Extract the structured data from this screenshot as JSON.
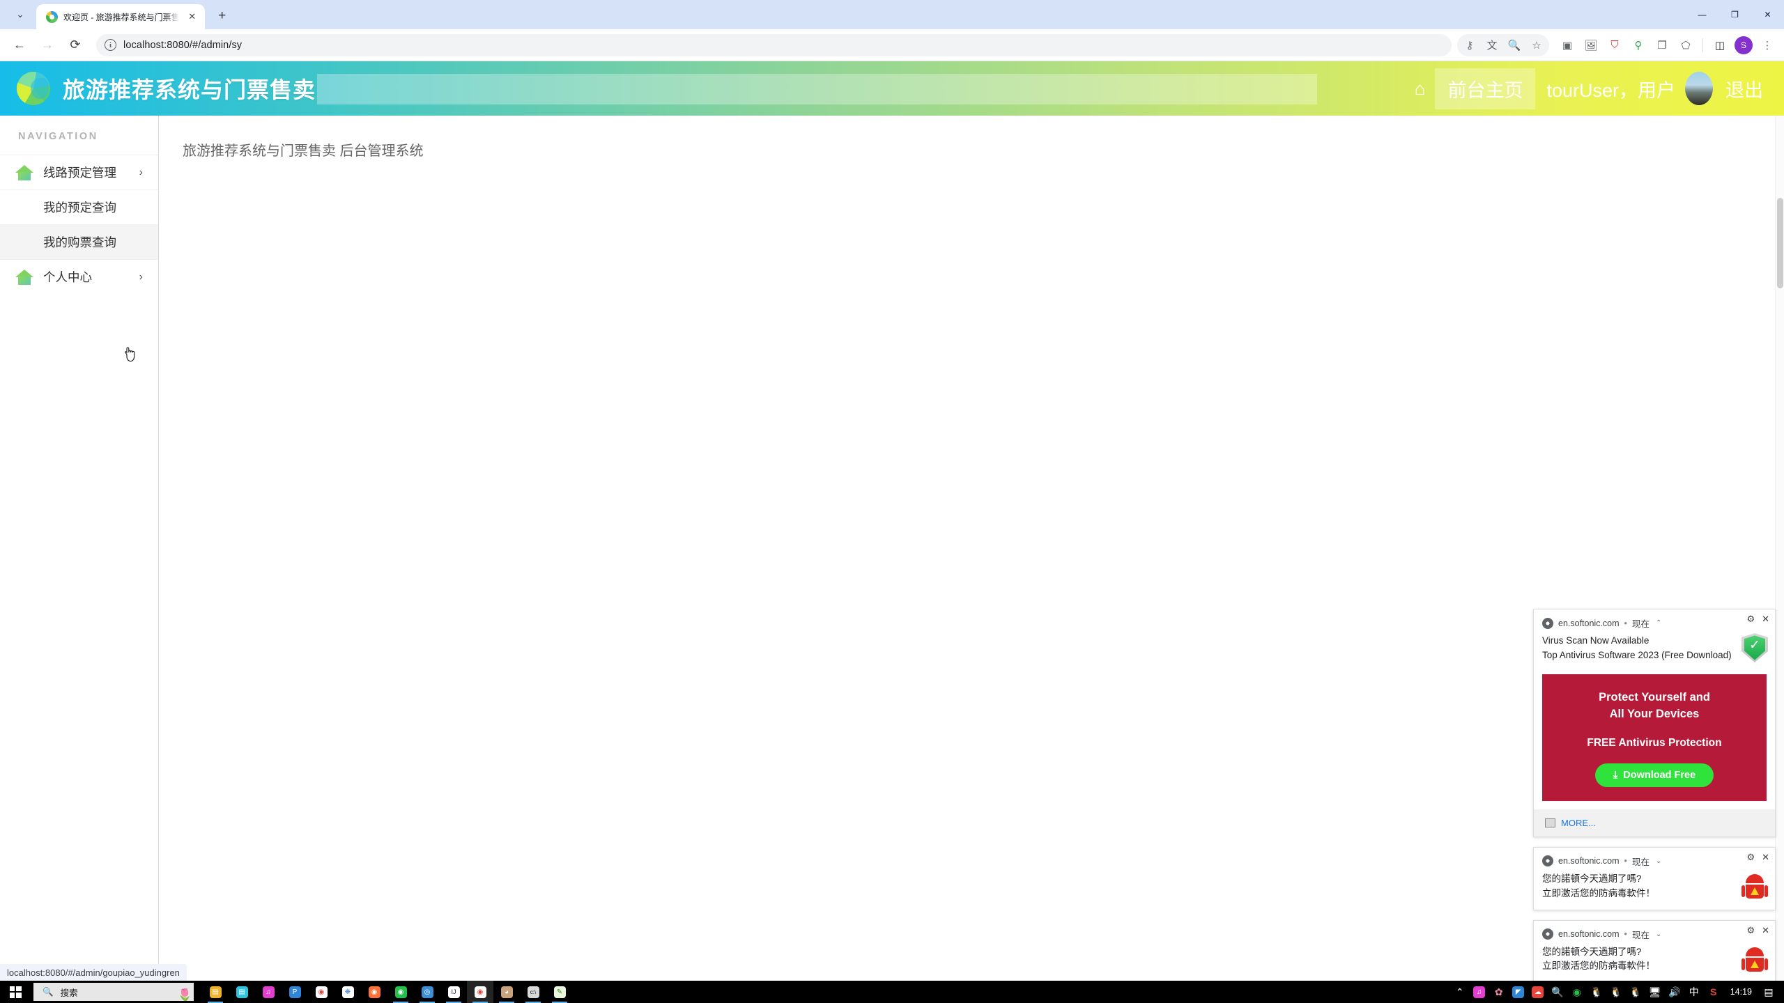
{
  "browser": {
    "tab": {
      "title": "欢迎页 - 旅游推荐系统与门票售",
      "close_label": "✕"
    },
    "new_tab_label": "+",
    "tab_chevron": "⌄",
    "window_controls": {
      "minimize": "—",
      "maximize": "❐",
      "close": "✕"
    },
    "nav": {
      "back": "←",
      "forward": "→",
      "reload": "⟳"
    },
    "omnibox": {
      "url": "localhost:8080/#/admin/sy",
      "info_icon": "i"
    },
    "toolbar_icons": [
      {
        "name": "password-key-icon",
        "glyph": "⚷"
      },
      {
        "name": "translate-icon",
        "glyph": "文"
      },
      {
        "name": "zoom-icon",
        "glyph": "🔍"
      },
      {
        "name": "bookmark-star-icon",
        "glyph": "☆"
      },
      {
        "name": "screenshot-camera-icon",
        "glyph": "▣"
      },
      {
        "name": "image-extension-icon",
        "glyph": "🖼"
      },
      {
        "name": "adblock-shield-icon",
        "glyph": "⛉"
      },
      {
        "name": "location-pin-icon",
        "glyph": "⚲"
      },
      {
        "name": "clipboard-copy-icon",
        "glyph": "❐"
      },
      {
        "name": "puzzle-extensions-icon",
        "glyph": "⬠"
      },
      {
        "name": "side-panel-icon",
        "glyph": "◫"
      },
      {
        "name": "profile-avatar",
        "glyph": "S"
      },
      {
        "name": "chrome-menu-icon",
        "glyph": "⋮"
      }
    ]
  },
  "app": {
    "header": {
      "title": "旅游推荐系统与门票售卖",
      "home_icon": "⌂",
      "front_page_button": "前台主页",
      "user_label": "tourUser，用户",
      "logout_label": "退出",
      "gradient_from": "#16bde8",
      "gradient_to": "#eef444"
    },
    "sidebar": {
      "section_label": "NAVIGATION",
      "items": [
        {
          "label": "线路预定管理",
          "icon": "home-icon",
          "chevron": "›",
          "has_icon": true,
          "sub": false,
          "active": false
        },
        {
          "label": "我的预定查询",
          "icon": "",
          "chevron": "",
          "has_icon": false,
          "sub": true,
          "active": false
        },
        {
          "label": "我的购票查询",
          "icon": "",
          "chevron": "",
          "has_icon": false,
          "sub": true,
          "active": true
        },
        {
          "label": "个人中心",
          "icon": "home-icon",
          "chevron": "›",
          "has_icon": true,
          "sub": false,
          "active": false
        }
      ]
    },
    "content": {
      "title": "旅游推荐系统与门票售卖 后台管理系统"
    }
  },
  "status_bar": {
    "url": "localhost:8080/#/admin/goupiao_yudingren"
  },
  "notifications": [
    {
      "source": "en.softonic.com",
      "separator": "•",
      "time": "现在",
      "caret": "⌃",
      "settings_icon": "⚙",
      "close_icon": "✕",
      "line1": "Virus Scan Now Available",
      "line2": "Top Antivirus Software 2023 (Free Download)",
      "image": "shield-check-icon",
      "promo": {
        "headline_1": "Protect Yourself and",
        "headline_2": "All Your Devices",
        "subline": "FREE Antivirus Protection",
        "button": "Download Free",
        "button_icon": "⤓",
        "bg_color": "#b51b38",
        "button_color": "#2fe23c"
      },
      "more_label": "MORE..."
    },
    {
      "source": "en.softonic.com",
      "separator": "•",
      "time": "现在",
      "caret": "⌄",
      "settings_icon": "⚙",
      "close_icon": "✕",
      "line1": "您的諾頓今天過期了嗎?",
      "line2": "立即激活您的防病毒軟件！",
      "image": "android-warning-icon"
    },
    {
      "source": "en.softonic.com",
      "separator": "•",
      "time": "现在",
      "caret": "⌄",
      "settings_icon": "⚙",
      "close_icon": "✕",
      "line1": "您的諾頓今天過期了嗎?",
      "line2": "立即激活您的防病毒軟件！",
      "image": "android-warning-icon"
    }
  ],
  "taskbar": {
    "start_label": "start-button",
    "search_placeholder": "搜索",
    "search_icon": "🔍",
    "apps": [
      {
        "name": "file-explorer-icon",
        "glyph": "🗂",
        "color": "#f0b429"
      },
      {
        "name": "toolbox-app-icon",
        "glyph": "▤",
        "color": "#2ec4e0"
      },
      {
        "name": "netease-music-icon",
        "glyph": "♫",
        "color": "#e23fd0"
      },
      {
        "name": "pdf-app-icon",
        "glyph": "P",
        "color": "#2f86d8"
      },
      {
        "name": "chrome-icon",
        "glyph": "◉",
        "color": "#e7453c"
      },
      {
        "name": "white-app-icon",
        "glyph": "❋",
        "color": "#ffffff"
      },
      {
        "name": "firefox-icon",
        "glyph": "◉",
        "color": "#ff7139"
      },
      {
        "name": "wechat-icon",
        "glyph": "◉",
        "color": "#23c04a"
      },
      {
        "name": "music-app-icon",
        "glyph": "◎",
        "color": "#3a8fd6"
      },
      {
        "name": "intellij-idea-icon",
        "glyph": "IJ",
        "color": "#ffffff"
      },
      {
        "name": "chrome-active-icon",
        "glyph": "◉",
        "color": "#e7453c"
      },
      {
        "name": "browser-app-icon",
        "glyph": "◕",
        "color": "#c9a27e"
      },
      {
        "name": "cmd-terminal-icon",
        "glyph": "▭",
        "color": "#d8d8d8"
      },
      {
        "name": "notepad-icon",
        "glyph": "✎",
        "color": "#8ed16b"
      }
    ],
    "tray": [
      {
        "name": "tray-expand-icon",
        "glyph": "⌃",
        "color": "#ffffff"
      },
      {
        "name": "netease-tray-icon",
        "glyph": "♫",
        "color": "#e23fd0"
      },
      {
        "name": "sakura-tray-icon",
        "glyph": "✿",
        "color": "#f48fb1"
      },
      {
        "name": "teambition-tray-icon",
        "glyph": "◤",
        "color": "#2f86d8"
      },
      {
        "name": "cloud-tray-icon",
        "glyph": "☁",
        "color": "#e7453c"
      },
      {
        "name": "search-tray-icon",
        "glyph": "🔍",
        "color": "#f0a429"
      },
      {
        "name": "wechat-tray-icon",
        "glyph": "◉",
        "color": "#23c04a"
      },
      {
        "name": "qq-tray-icon-1",
        "glyph": "🐧",
        "color": "#ffffff"
      },
      {
        "name": "qq-tray-icon-2",
        "glyph": "🐧",
        "color": "#ffffff"
      },
      {
        "name": "qq-tray-icon-3",
        "glyph": "🐧",
        "color": "#ffffff"
      },
      {
        "name": "network-tray-icon",
        "glyph": "🖥",
        "color": "#ffffff"
      },
      {
        "name": "volume-tray-icon",
        "glyph": "🔊",
        "color": "#ffffff"
      },
      {
        "name": "ime-chinese-icon",
        "glyph": "中",
        "color": "#ffffff"
      },
      {
        "name": "sogou-tray-icon",
        "glyph": "S",
        "color": "#e7453c"
      }
    ],
    "clock": "14:19",
    "notification_center_icon": "▤"
  }
}
